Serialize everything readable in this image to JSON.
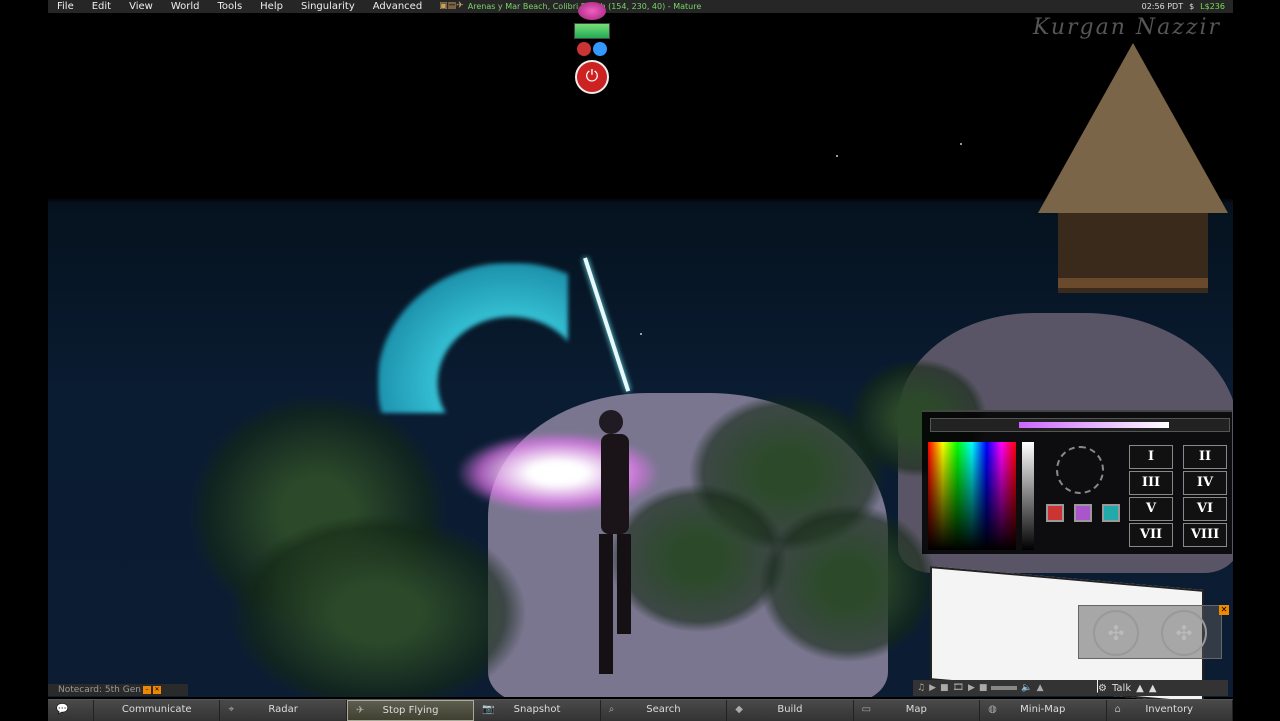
{
  "menu": {
    "items": [
      "File",
      "Edit",
      "View",
      "World",
      "Tools",
      "Help",
      "Singularity",
      "Advanced"
    ],
    "location": "Arenas y Mar Beach, Colibri Beach (154, 230, 40) - Mature",
    "time": "02:56 PDT",
    "balance": "L$236"
  },
  "watermark": "Kurgan Nazzir",
  "picker": {
    "buttons": [
      "I",
      "II",
      "III",
      "IV",
      "V",
      "VI",
      "VII",
      "VIII"
    ]
  },
  "notecard": {
    "label": "Notecard: 5th Gen"
  },
  "talk": {
    "label": "Talk"
  },
  "toolbar": {
    "communicate": "Communicate",
    "radar": "Radar",
    "stop_flying": "Stop Flying",
    "snapshot": "Snapshot",
    "search": "Search",
    "build": "Build",
    "map": "Map",
    "minimap": "Mini-Map",
    "inventory": "Inventory"
  },
  "colors": {
    "menubar": "#262626",
    "toolbar": "#3a3a3a",
    "location": "#7bd36a",
    "balance": "#77dd55"
  }
}
